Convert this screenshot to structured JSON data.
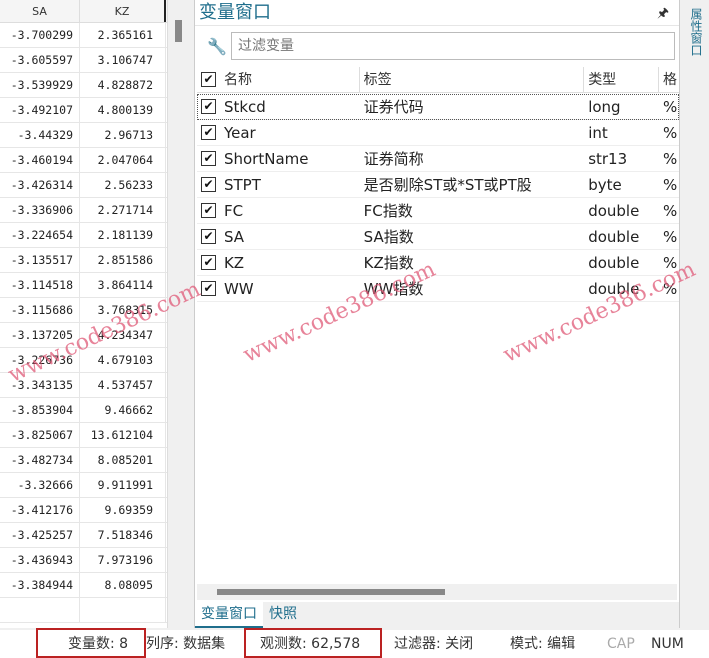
{
  "grid": {
    "columns": [
      "SA",
      "KZ"
    ],
    "rows": [
      [
        "-3.700299",
        "2.365161"
      ],
      [
        "-3.605597",
        "3.106747"
      ],
      [
        "-3.539929",
        "4.828872"
      ],
      [
        "-3.492107",
        "4.800139"
      ],
      [
        "-3.44329",
        "2.96713"
      ],
      [
        "-3.460194",
        "2.047064"
      ],
      [
        "-3.426314",
        "2.56233"
      ],
      [
        "-3.336906",
        "2.271714"
      ],
      [
        "-3.224654",
        "2.181139"
      ],
      [
        "-3.135517",
        "2.851586"
      ],
      [
        "-3.114518",
        "3.864114"
      ],
      [
        "-3.115686",
        "3.768315"
      ],
      [
        "-3.137205",
        "4.234347"
      ],
      [
        "-3.226736",
        "4.679103"
      ],
      [
        "-3.343135",
        "4.537457"
      ],
      [
        "-3.853904",
        "9.46662"
      ],
      [
        "-3.825067",
        "13.612104"
      ],
      [
        "-3.482734",
        "8.085201"
      ],
      [
        "-3.32666",
        "9.911991"
      ],
      [
        "-3.412176",
        "9.69359"
      ],
      [
        "-3.425257",
        "7.518346"
      ],
      [
        "-3.436943",
        "7.973196"
      ],
      [
        "-3.384944",
        "8.08095"
      ],
      [
        "",
        ""
      ]
    ]
  },
  "panel": {
    "title": "变量窗口",
    "pin_icon": "pin-icon",
    "filter_placeholder": "过滤变量",
    "headers": {
      "check": "✔",
      "name": "名称",
      "label": "标签",
      "type": "类型",
      "format": "格"
    },
    "variables": [
      {
        "name": "Stkcd",
        "label": "证券代码",
        "type": "long",
        "format": "%"
      },
      {
        "name": "Year",
        "label": "",
        "type": "int",
        "format": "%"
      },
      {
        "name": "ShortName",
        "label": "证券简称",
        "type": "str13",
        "format": "%"
      },
      {
        "name": "STPT",
        "label": "是否剔除ST或*ST或PT股",
        "type": "byte",
        "format": "%"
      },
      {
        "name": "FC",
        "label": "FC指数",
        "type": "double",
        "format": "%"
      },
      {
        "name": "SA",
        "label": "SA指数",
        "type": "double",
        "format": "%"
      },
      {
        "name": "KZ",
        "label": "KZ指数",
        "type": "double",
        "format": "%"
      },
      {
        "name": "WW",
        "label": "WW指数",
        "type": "double",
        "format": "%"
      }
    ],
    "tabs": [
      "变量窗口",
      "快照"
    ]
  },
  "right_strip": {
    "label": "属性窗口"
  },
  "status": {
    "vars": "变量数: 8",
    "order": "列序: 数据集",
    "obs": "观测数: 62,578",
    "filter": "过滤器: 关闭",
    "mode": "模式: 编辑",
    "cap": "CAP",
    "num": "NUM"
  },
  "watermark": "www.code386.com",
  "colors": {
    "accent": "#1f6e8c",
    "highlight": "#b22222",
    "watermark": "#e05a78"
  }
}
